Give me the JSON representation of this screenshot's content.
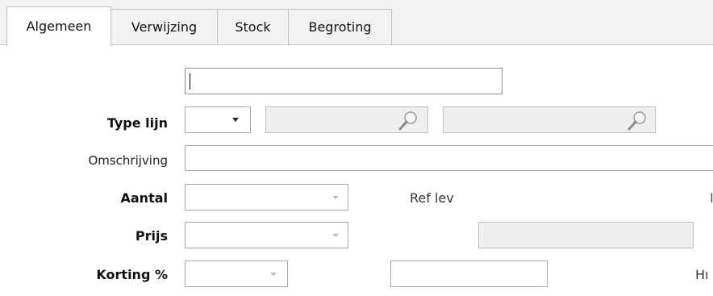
{
  "tabs": [
    {
      "label": "Algemeen",
      "active": true
    },
    {
      "label": "Verwijzing",
      "active": false
    },
    {
      "label": "Stock",
      "active": false
    },
    {
      "label": "Begroting",
      "active": false
    }
  ],
  "form": {
    "top_field_value": "",
    "type_lijn_label": "Type lijn",
    "type_lijn_value": "",
    "search1_value": "",
    "search2_value": "",
    "omschrijving_label": "Omschrijving",
    "omschrijving_value": "",
    "aantal_label": "Aantal",
    "aantal_value": "",
    "ref_lev_label": "Ref lev",
    "prijs_label": "Prijs",
    "prijs_value": "",
    "korting_label": "Korting %",
    "korting_value": "",
    "korting_extra_value": "",
    "truncated_label_right": "Hı",
    "truncated_mark_right": "I"
  },
  "icons": {
    "dropdown": "chevron-down-icon",
    "search": "magnifier-icon"
  },
  "colors": {
    "tab_bg": "#f2f2f2",
    "field_border": "#a8a8a8",
    "disabled_bg": "#efefef"
  }
}
